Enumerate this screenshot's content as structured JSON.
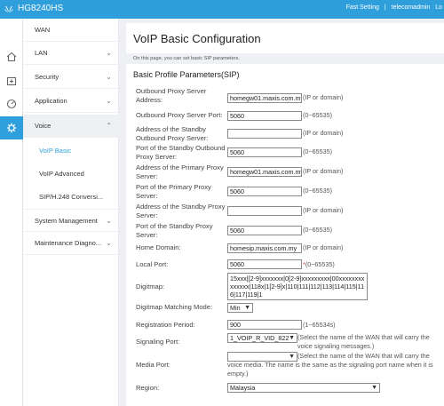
{
  "header": {
    "brand": "HG8240HS",
    "fast_setting": "Fast Setting",
    "separator": "|",
    "user": "telecomadmin",
    "logout": "Lo"
  },
  "sidebar": {
    "items": [
      {
        "label": "WAN"
      },
      {
        "label": "LAN"
      },
      {
        "label": "Security"
      },
      {
        "label": "Application"
      },
      {
        "label": "Voice"
      },
      {
        "label": "VoIP Basic"
      },
      {
        "label": "VoIP Advanced"
      },
      {
        "label": "SIP/H.248 Conversi..."
      },
      {
        "label": "System Management"
      },
      {
        "label": "Maintenance Diagno..."
      }
    ]
  },
  "page": {
    "title": "VoIP Basic Configuration",
    "description": "On this page, you can set basic SIP parameters.",
    "section": "Basic Profile Parameters(SIP)"
  },
  "form": {
    "outbound_proxy_address": {
      "label": "Outbound Proxy Server Address:",
      "value": "homegw01.maxis.com.my",
      "note": "(IP or domain)"
    },
    "outbound_proxy_port": {
      "label": "Outbound Proxy Server Port:",
      "value": "5060",
      "note": "(0~65535)"
    },
    "standby_outbound_address": {
      "label": "Address of the Standby Outbound Proxy Server:",
      "value": "",
      "note": "(IP or domain)"
    },
    "standby_outbound_port": {
      "label": "Port of the Standby Outbound Proxy Server:",
      "value": "5060",
      "note": "(0~65535)"
    },
    "primary_proxy_address": {
      "label": "Address of the Primary Proxy Server:",
      "value": "homegw01.maxis.com.my",
      "note": "(IP or domain)"
    },
    "primary_proxy_port": {
      "label": "Port of the Primary Proxy Server:",
      "value": "5060",
      "note": "(0~65535)"
    },
    "standby_proxy_address": {
      "label": "Address of the Standby Proxy Server:",
      "value": "",
      "note": "(IP or domain)"
    },
    "standby_proxy_port": {
      "label": "Port of the Standby Proxy Server:",
      "value": "5060",
      "note": "(0~65535)"
    },
    "home_domain": {
      "label": "Home Domain:",
      "value": "homesip.maxis.com.my",
      "note": "(IP or domain)"
    },
    "local_port": {
      "label": "Local Port:",
      "value": "5060",
      "required": "*",
      "note": "(0~65535)"
    },
    "digitmap": {
      "label": "Digitmap:",
      "value": "15xxx|[2-9]xxxxxxx|0[2-9]xxxxxxxxx|00xxxxxxxxxxxxxx|118x|1[2-9]x|110|111|112|113|114|115|116|117|119|1"
    },
    "digitmap_mode": {
      "label": "Digitmap Matching Mode:",
      "value": "Min"
    },
    "registration_period": {
      "label": "Registration Period:",
      "value": "900",
      "note": "(1~65534s)"
    },
    "signaling_port": {
      "label": "Signaling Port:",
      "value": "1_VOIP_R_VID_822",
      "note": "(Select the name of the WAN that will carry the voice signaling messages.)"
    },
    "media_port": {
      "label": "Media Port:",
      "value": "",
      "note": "(Select the name of the WAN that will carry the voice media. The name is the same as the signaling port name when it is empty.)"
    },
    "region": {
      "label": "Region:",
      "value": "Malaysia"
    }
  },
  "colors": {
    "accent": "#2f9fdc",
    "required": "#e04040"
  },
  "icons": [
    "home-icon",
    "add-box-icon",
    "dashboard-gauge-icon",
    "gear-icon",
    "chevron-down-icon",
    "chevron-up-icon"
  ]
}
